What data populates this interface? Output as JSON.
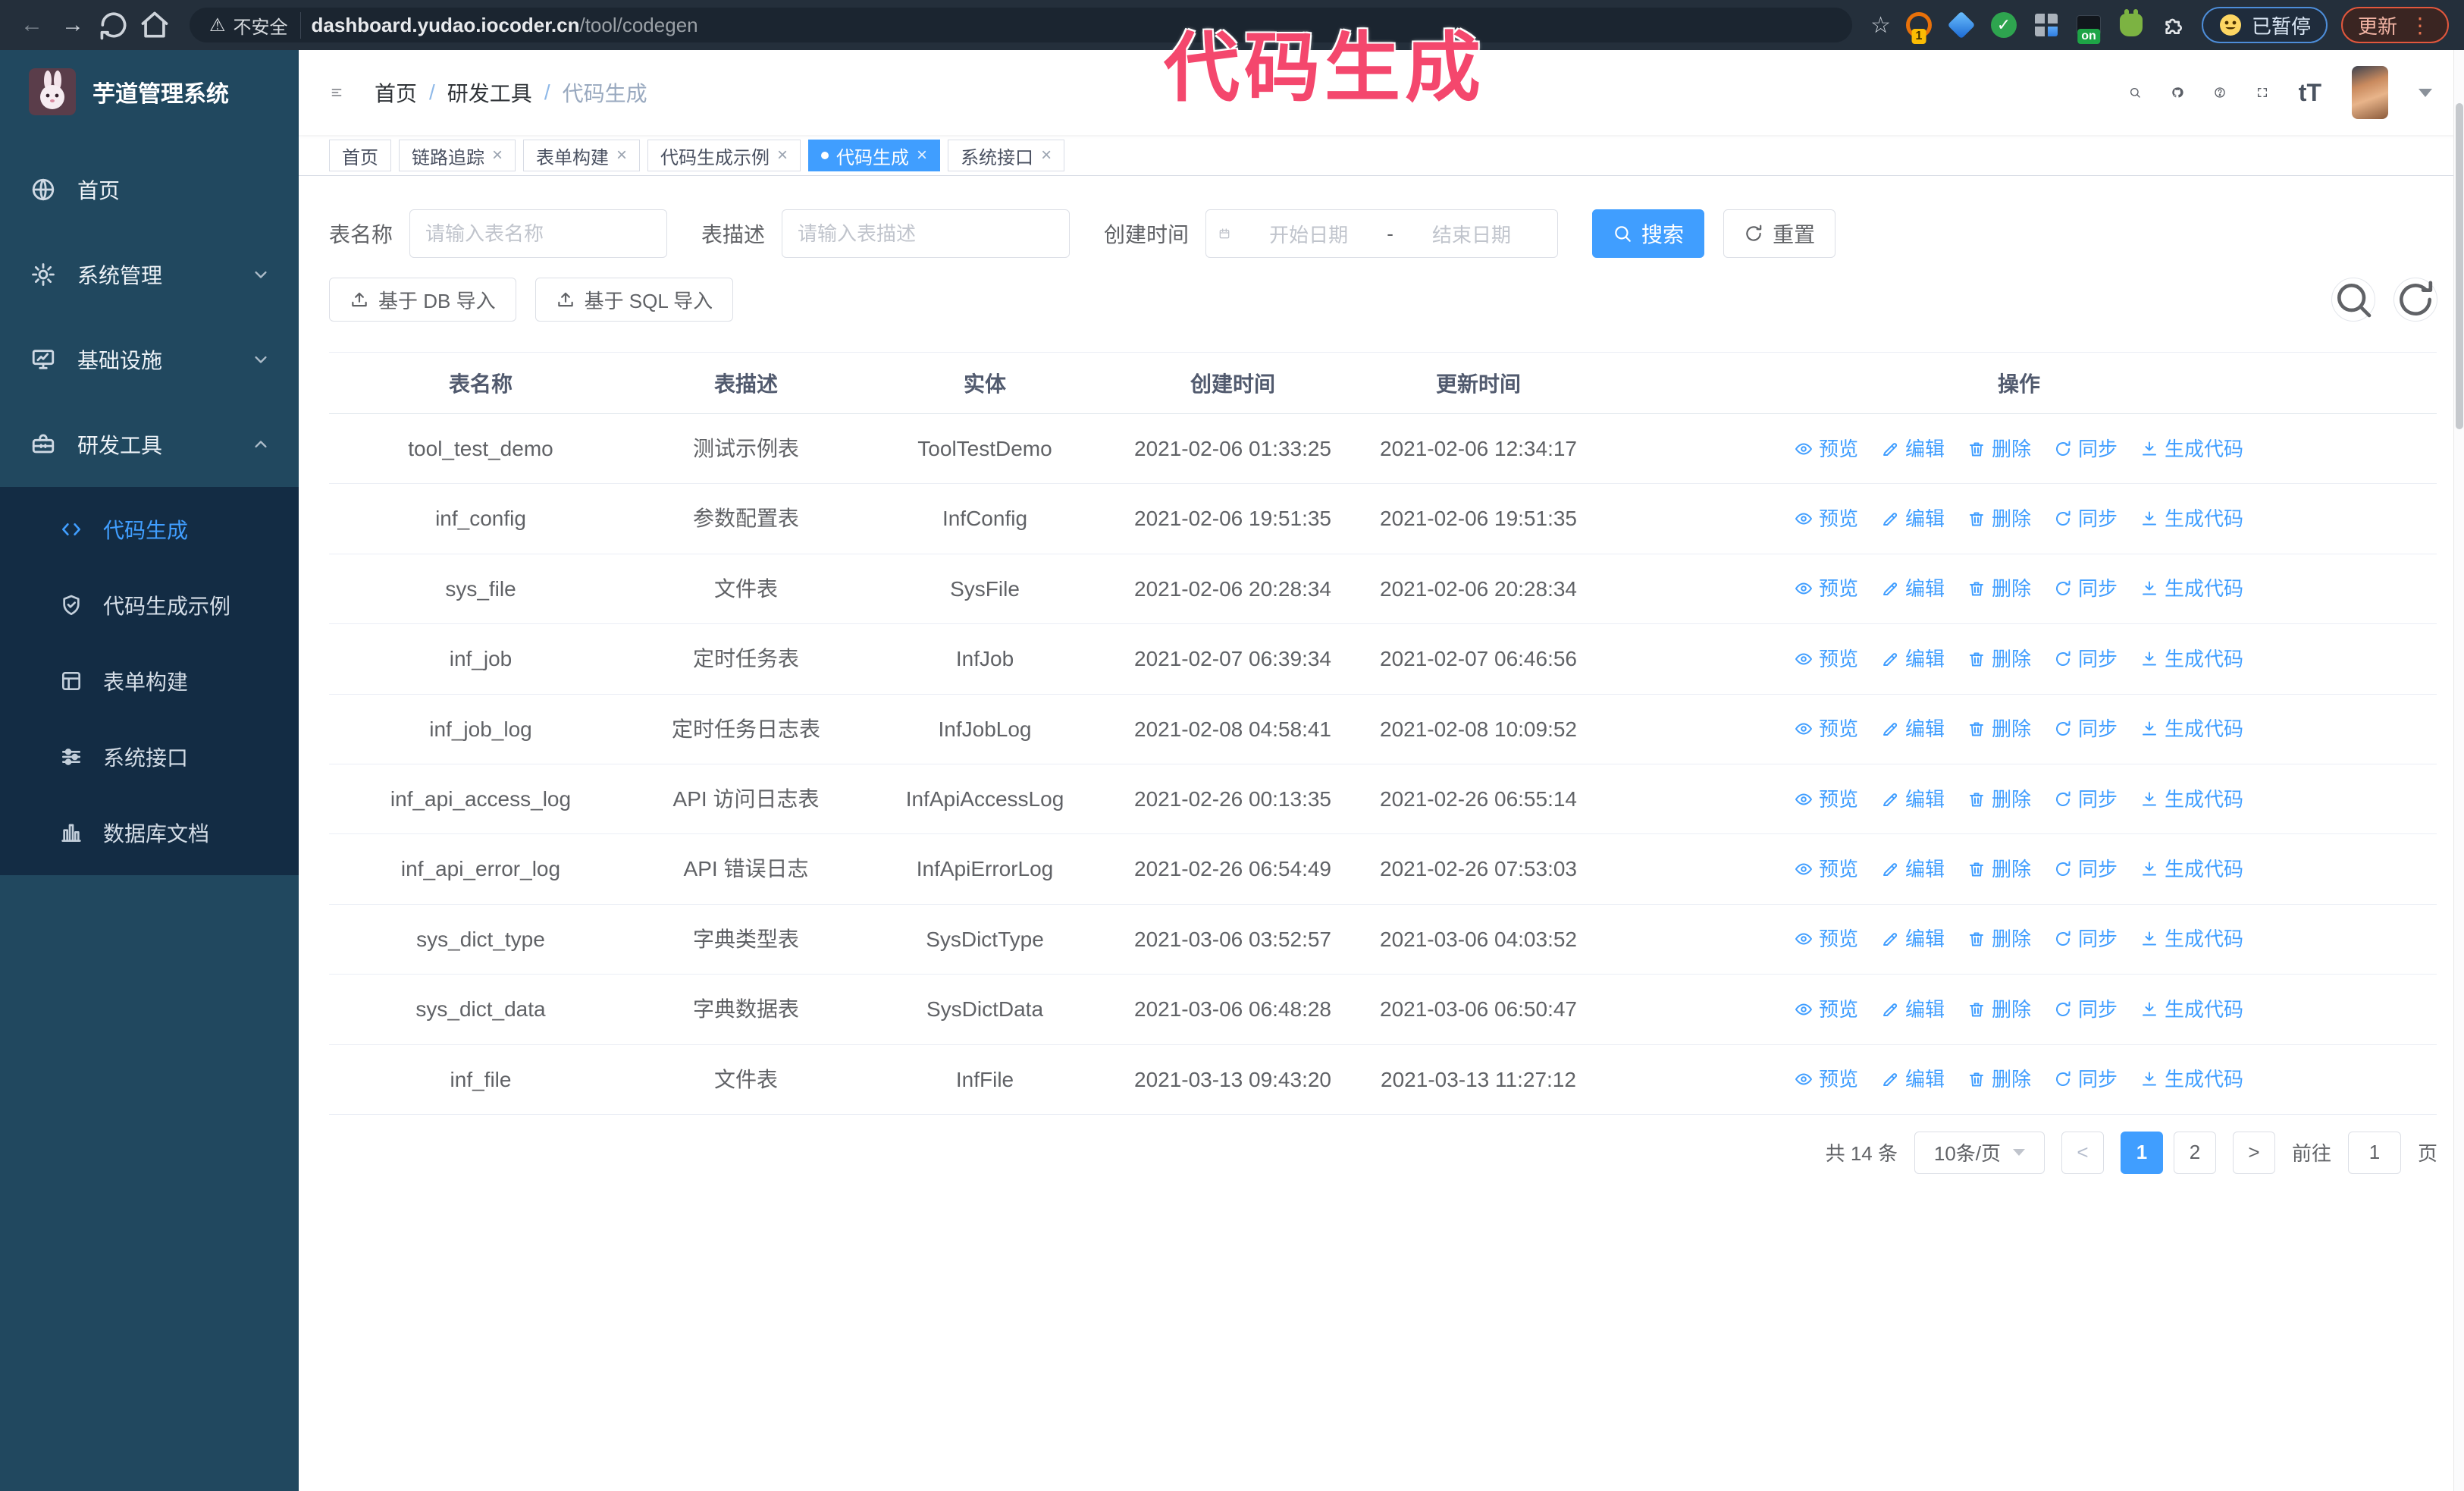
{
  "browser": {
    "security_label": "不安全",
    "url_domain": "dashboard.yudao.iocoder.cn",
    "url_path": "/tool/codegen",
    "extensions": [
      {
        "name": "extension-orange-circle",
        "badge": "1"
      },
      {
        "name": "extension-blue-gem",
        "badge": ""
      },
      {
        "name": "extension-green-check",
        "badge": ""
      },
      {
        "name": "extension-grid",
        "badge": ""
      },
      {
        "name": "extension-dark",
        "badge": "on"
      },
      {
        "name": "extension-green-bot",
        "badge": ""
      },
      {
        "name": "extensions-puzzle",
        "badge": ""
      }
    ],
    "paused_badge": "已暂停",
    "update_button": "更新"
  },
  "annotation": {
    "title": "代码生成"
  },
  "sidebar": {
    "app_title": "芋道管理系统",
    "items": [
      {
        "label": "首页",
        "icon": "home",
        "expandable": false,
        "state": "none"
      },
      {
        "label": "系统管理",
        "icon": "gear",
        "expandable": true,
        "state": "collapsed"
      },
      {
        "label": "基础设施",
        "icon": "monitor",
        "expandable": true,
        "state": "collapsed"
      },
      {
        "label": "研发工具",
        "icon": "toolbox",
        "expandable": true,
        "state": "expanded"
      }
    ],
    "submenu": [
      {
        "label": "代码生成",
        "icon": "code",
        "active": true
      },
      {
        "label": "代码生成示例",
        "icon": "shield",
        "active": false
      },
      {
        "label": "表单构建",
        "icon": "form",
        "active": false
      },
      {
        "label": "系统接口",
        "icon": "sliders",
        "active": false
      },
      {
        "label": "数据库文档",
        "icon": "database",
        "active": false
      }
    ]
  },
  "header": {
    "breadcrumb": [
      "首页",
      "研发工具",
      "代码生成"
    ]
  },
  "tabs": [
    {
      "label": "首页",
      "closable": false,
      "active": false
    },
    {
      "label": "链路追踪",
      "closable": true,
      "active": false
    },
    {
      "label": "表单构建",
      "closable": true,
      "active": false
    },
    {
      "label": "代码生成示例",
      "closable": true,
      "active": false
    },
    {
      "label": "代码生成",
      "closable": true,
      "active": true
    },
    {
      "label": "系统接口",
      "closable": true,
      "active": false
    }
  ],
  "filters": {
    "table_name_label": "表名称",
    "table_name_placeholder": "请输入表名称",
    "table_desc_label": "表描述",
    "table_desc_placeholder": "请输入表描述",
    "create_time_label": "创建时间",
    "date_start_placeholder": "开始日期",
    "date_separator": "-",
    "date_end_placeholder": "结束日期",
    "search_button": "搜索",
    "reset_button": "重置"
  },
  "toolbar": {
    "import_db_button": "基于 DB 导入",
    "import_sql_button": "基于 SQL 导入"
  },
  "table": {
    "columns": [
      "表名称",
      "表描述",
      "实体",
      "创建时间",
      "更新时间",
      "操作"
    ],
    "actions": [
      "预览",
      "编辑",
      "删除",
      "同步",
      "生成代码"
    ],
    "rows": [
      {
        "name": "tool_test_demo",
        "desc": "测试示例表",
        "entity": "ToolTestDemo",
        "created": "2021-02-06 01:33:25",
        "updated": "2021-02-06 12:34:17"
      },
      {
        "name": "inf_config",
        "desc": "参数配置表",
        "entity": "InfConfig",
        "created": "2021-02-06 19:51:35",
        "updated": "2021-02-06 19:51:35"
      },
      {
        "name": "sys_file",
        "desc": "文件表",
        "entity": "SysFile",
        "created": "2021-02-06 20:28:34",
        "updated": "2021-02-06 20:28:34"
      },
      {
        "name": "inf_job",
        "desc": "定时任务表",
        "entity": "InfJob",
        "created": "2021-02-07 06:39:34",
        "updated": "2021-02-07 06:46:56"
      },
      {
        "name": "inf_job_log",
        "desc": "定时任务日志表",
        "entity": "InfJobLog",
        "created": "2021-02-08 04:58:41",
        "updated": "2021-02-08 10:09:52"
      },
      {
        "name": "inf_api_access_log",
        "desc": "API 访问日志表",
        "entity": "InfApiAccessLog",
        "created": "2021-02-26 00:13:35",
        "updated": "2021-02-26 06:55:14"
      },
      {
        "name": "inf_api_error_log",
        "desc": "API 错误日志",
        "entity": "InfApiErrorLog",
        "created": "2021-02-26 06:54:49",
        "updated": "2021-02-26 07:53:03"
      },
      {
        "name": "sys_dict_type",
        "desc": "字典类型表",
        "entity": "SysDictType",
        "created": "2021-03-06 03:52:57",
        "updated": "2021-03-06 04:03:52"
      },
      {
        "name": "sys_dict_data",
        "desc": "字典数据表",
        "entity": "SysDictData",
        "created": "2021-03-06 06:48:28",
        "updated": "2021-03-06 06:50:47"
      },
      {
        "name": "inf_file",
        "desc": "文件表",
        "entity": "InfFile",
        "created": "2021-03-13 09:43:20",
        "updated": "2021-03-13 11:27:12"
      }
    ]
  },
  "pagination": {
    "total_text": "共 14 条",
    "page_size": "10条/页",
    "pages": [
      {
        "label": "1",
        "active": true
      },
      {
        "label": "2",
        "active": false
      }
    ],
    "goto_label": "前往",
    "goto_value": "1",
    "goto_suffix": "页"
  },
  "icons_text": {
    "close": "×",
    "back_arrow": "←",
    "forward_arrow": "→",
    "star": "☆",
    "warning": "⚠",
    "check": "✓",
    "ellipsis": "⋮",
    "text_size": "tT",
    "prev": "<",
    "next": ">"
  },
  "colors": {
    "accent": "#409eff",
    "annotation": "#f4476d",
    "sidebar_bg": "#21485f",
    "submenu_bg": "#132c44"
  }
}
